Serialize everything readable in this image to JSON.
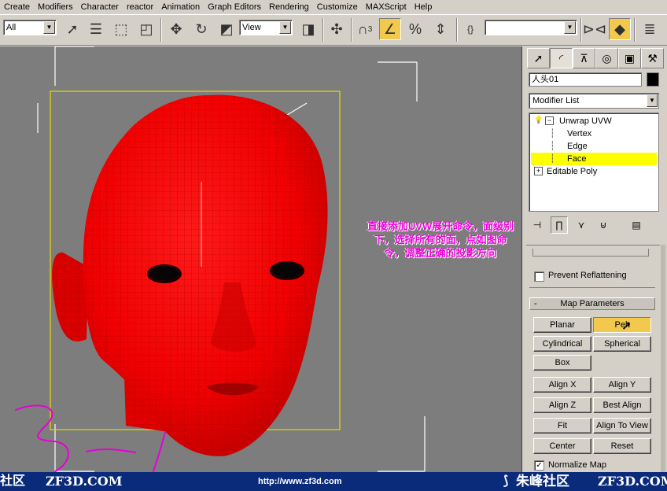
{
  "menu": [
    "Create",
    "Modifiers",
    "Character",
    "reactor",
    "Animation",
    "Graph Editors",
    "Rendering",
    "Customize",
    "MAXScript",
    "Help"
  ],
  "toolbar": {
    "selection_filter": "All",
    "ref_coord": "View",
    "named_selection": "",
    "snap_label": "3",
    "icons": [
      "select-arrow-icon",
      "select-by-name-icon",
      "rect-region-icon",
      "window-crossing-icon",
      "move-icon",
      "rotate-icon",
      "scale-icon",
      "pivot-icon",
      "manipulate-icon",
      "snap-toggle-icon",
      "angle-snap-icon",
      "percent-snap-icon",
      "spinner-snap-icon",
      "edit-named-sel-icon",
      "mirror-icon",
      "align-icon",
      "layer-manager-icon"
    ]
  },
  "viewport": {
    "annotation": "直接添加UVW展开命令，面级别下，选择所有的面，点如图命令，调整正确的投影方向",
    "face_color": "#ff0000",
    "background_color": "#7d7d7d"
  },
  "panel": {
    "tabs": [
      "create-tab",
      "modify-tab",
      "hierarchy-tab",
      "motion-tab",
      "display-tab",
      "utilities-tab"
    ],
    "object_name": "人头01",
    "modifier_list_label": "Modifier List",
    "stack": [
      {
        "label": "Unwrap UVW",
        "icon": "bulb-icon",
        "expander": "⊟"
      },
      {
        "label": "Vertex"
      },
      {
        "label": "Edge"
      },
      {
        "label": "Face",
        "selected": true
      },
      {
        "label": "Editable Poly",
        "expander": "⊞"
      }
    ],
    "prevent_reflattening": "Prevent Reflattening",
    "map_params_title": "Map Parameters",
    "buttons": [
      [
        "Planar",
        "Pelt"
      ],
      [
        "Cylindrical",
        "Spherical"
      ],
      [
        "Box",
        ""
      ],
      [
        "Align X",
        "Align Y"
      ],
      [
        "Align Z",
        "Best Align"
      ],
      [
        "Fit",
        "Align To View"
      ],
      [
        "Center",
        "Reset"
      ]
    ],
    "normalize_map": "Normalize Map"
  },
  "watermark": {
    "left": "社区",
    "left_site": "ZF3D.COM",
    "url": "http://www.zf3d.com",
    "right_brand": "朱峰社区",
    "right_site": "ZF3D.COM"
  }
}
